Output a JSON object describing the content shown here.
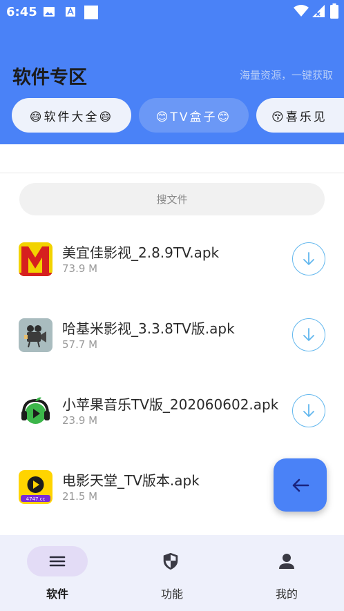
{
  "status_bar": {
    "time": "6:45"
  },
  "header": {
    "title": "软件专区",
    "subtitle": "海量资源，一键获取",
    "chips": [
      {
        "label": "😄软件大全😄"
      },
      {
        "label": "😊TV盒子😊"
      },
      {
        "label": "😚喜乐见"
      }
    ]
  },
  "search": {
    "placeholder": "搜文件"
  },
  "files": [
    {
      "name": "美宜佳影视_2.8.9TV.apk",
      "size": "73.9 M"
    },
    {
      "name": "哈基米影视_3.3.8TV版.apk",
      "size": "57.7 M"
    },
    {
      "name": "小苹果音乐TV版_202060602.apk",
      "size": "23.9 M"
    },
    {
      "name": "电影天堂_TV版本.apk",
      "size": "21.5 M",
      "icon_caption": "4747.cc"
    }
  ],
  "bottom_nav": {
    "items": [
      {
        "label": "软件",
        "icon": "menu-icon",
        "active": true
      },
      {
        "label": "功能",
        "icon": "shield-icon",
        "active": false
      },
      {
        "label": "我的",
        "icon": "person-icon",
        "active": false
      }
    ]
  },
  "colors": {
    "header_bg": "#4a82f7",
    "accent": "#62b7ee",
    "nav_bg": "#eef0fb",
    "nav_active_pill": "#e3dcf6"
  }
}
